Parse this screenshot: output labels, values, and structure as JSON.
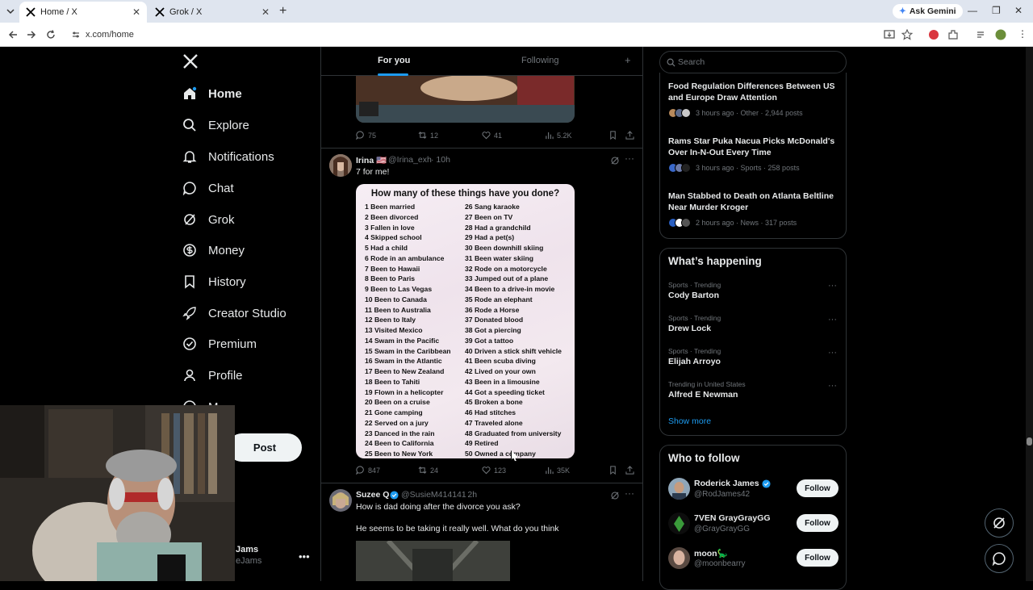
{
  "browser": {
    "tabs": [
      {
        "title": "Home / X",
        "active": true
      },
      {
        "title": "Grok / X",
        "active": false
      }
    ],
    "url": "x.com/home",
    "ask_gemini": "Ask Gemini"
  },
  "nav": {
    "items": [
      {
        "label": "Home",
        "icon": "home-icon"
      },
      {
        "label": "Explore",
        "icon": "search-icon"
      },
      {
        "label": "Notifications",
        "icon": "bell-icon"
      },
      {
        "label": "Chat",
        "icon": "chat-icon"
      },
      {
        "label": "Grok",
        "icon": "grok-icon"
      },
      {
        "label": "Money",
        "icon": "money-icon"
      },
      {
        "label": "History",
        "icon": "bookmark-icon"
      },
      {
        "label": "Creator Studio",
        "icon": "rocket-icon"
      },
      {
        "label": "Premium",
        "icon": "verified-icon"
      },
      {
        "label": "Profile",
        "icon": "person-icon"
      },
      {
        "label": "M",
        "icon": "more-icon"
      }
    ],
    "post_label": "Post",
    "account_name": "Jams",
    "account_handle": "eJams"
  },
  "feed": {
    "tabs": [
      "For you",
      "Following"
    ],
    "post1_actions": {
      "replies": "75",
      "reposts": "12",
      "likes": "41",
      "views": "5.2K"
    },
    "post2": {
      "name": "Irina 🇺🇸",
      "handle": "@Irina_exh",
      "time": "· 10h",
      "text": "7 for me!",
      "image_title": "How many of these things have you done?",
      "list_left": [
        "1  Been married",
        "2 Been divorced",
        "3 Fallen in love",
        "4 Skipped school",
        "5 Had a child",
        "6 Rode in an ambulance",
        "7 Been to Hawaii",
        "8 Been to Paris",
        "9 Been to Las Vegas",
        "10 Been to Canada",
        "11 Been to Australia",
        "12 Been to Italy",
        "13 Visited Mexico",
        "14 Swam in the Pacific",
        "15 Swam in the Caribbean",
        "16 Swam in the Atlantic",
        "17 Been to New Zealand",
        "18 Been to Tahiti",
        "19 Flown in a helicopter",
        "20 Been on a cruise",
        "21 Gone camping",
        "22 Served on a jury",
        "23 Danced in the rain",
        "24 Been to California",
        "25 Been to New York"
      ],
      "list_right": [
        "26 Sang karaoke",
        "27 Been on TV",
        "28 Had a grandchild",
        "29 Had a pet(s)",
        "30 Been downhill skiing",
        "31 Been water skiing",
        "32 Rode on a motorcycle",
        "33 Jumped out of a plane",
        "34 Been to a drive-in movie",
        "35 Rode an elephant",
        "36 Rode a Horse",
        "37 Donated blood",
        "38 Got a piercing",
        "39 Got a tattoo",
        "40 Driven a stick shift vehicle",
        "41 Been scuba diving",
        "42 Lived on your own",
        "43 Been in a limousine",
        "44 Got a speeding ticket",
        "45 Broken a bone",
        "46 Had stitches",
        "47 Traveled alone",
        "48 Graduated from university",
        "49 Retired",
        "50 Owned a company"
      ],
      "actions": {
        "replies": "847",
        "reposts": "24",
        "likes": "123",
        "views": "35K"
      }
    },
    "post3": {
      "name": "Suzee Q",
      "handle": "@SusieM414141",
      "time": "· 2h",
      "line1": "How is dad doing after the divorce you ask?",
      "line2": "He seems to be taking it really well. What do you think"
    }
  },
  "right": {
    "search_placeholder": "Search",
    "news": [
      {
        "title": "Food Regulation Differences Between US and Europe Draw Attention",
        "meta": "3 hours ago · Other · 2,944 posts"
      },
      {
        "title": "Rams Star Puka Nacua Picks McDonald's Over In-N-Out Every Time",
        "meta": "3 hours ago · Sports · 258 posts"
      },
      {
        "title": "Man Stabbed to Death on Atlanta Beltline Near Murder Kroger",
        "meta": "2 hours ago · News · 317 posts"
      }
    ],
    "happening_title": "What’s happening",
    "trends": [
      {
        "meta": "Sports · Trending",
        "name": "Cody Barton"
      },
      {
        "meta": "Sports · Trending",
        "name": "Drew Lock"
      },
      {
        "meta": "Sports · Trending",
        "name": "Elijah Arroyo"
      },
      {
        "meta": "Trending in United States",
        "name": "Alfred E Newman"
      }
    ],
    "show_more": "Show more",
    "wtf_title": "Who to follow",
    "follow_label": "Follow",
    "who_to_follow": [
      {
        "name": "Roderick James",
        "handle": "@RodJames42",
        "verified": true
      },
      {
        "name": "7VEN GrayGrayGG",
        "handle": "@GrayGrayGG",
        "verified": false
      },
      {
        "name": "moon🦕",
        "handle": "@moonbearry",
        "verified": false
      }
    ]
  }
}
